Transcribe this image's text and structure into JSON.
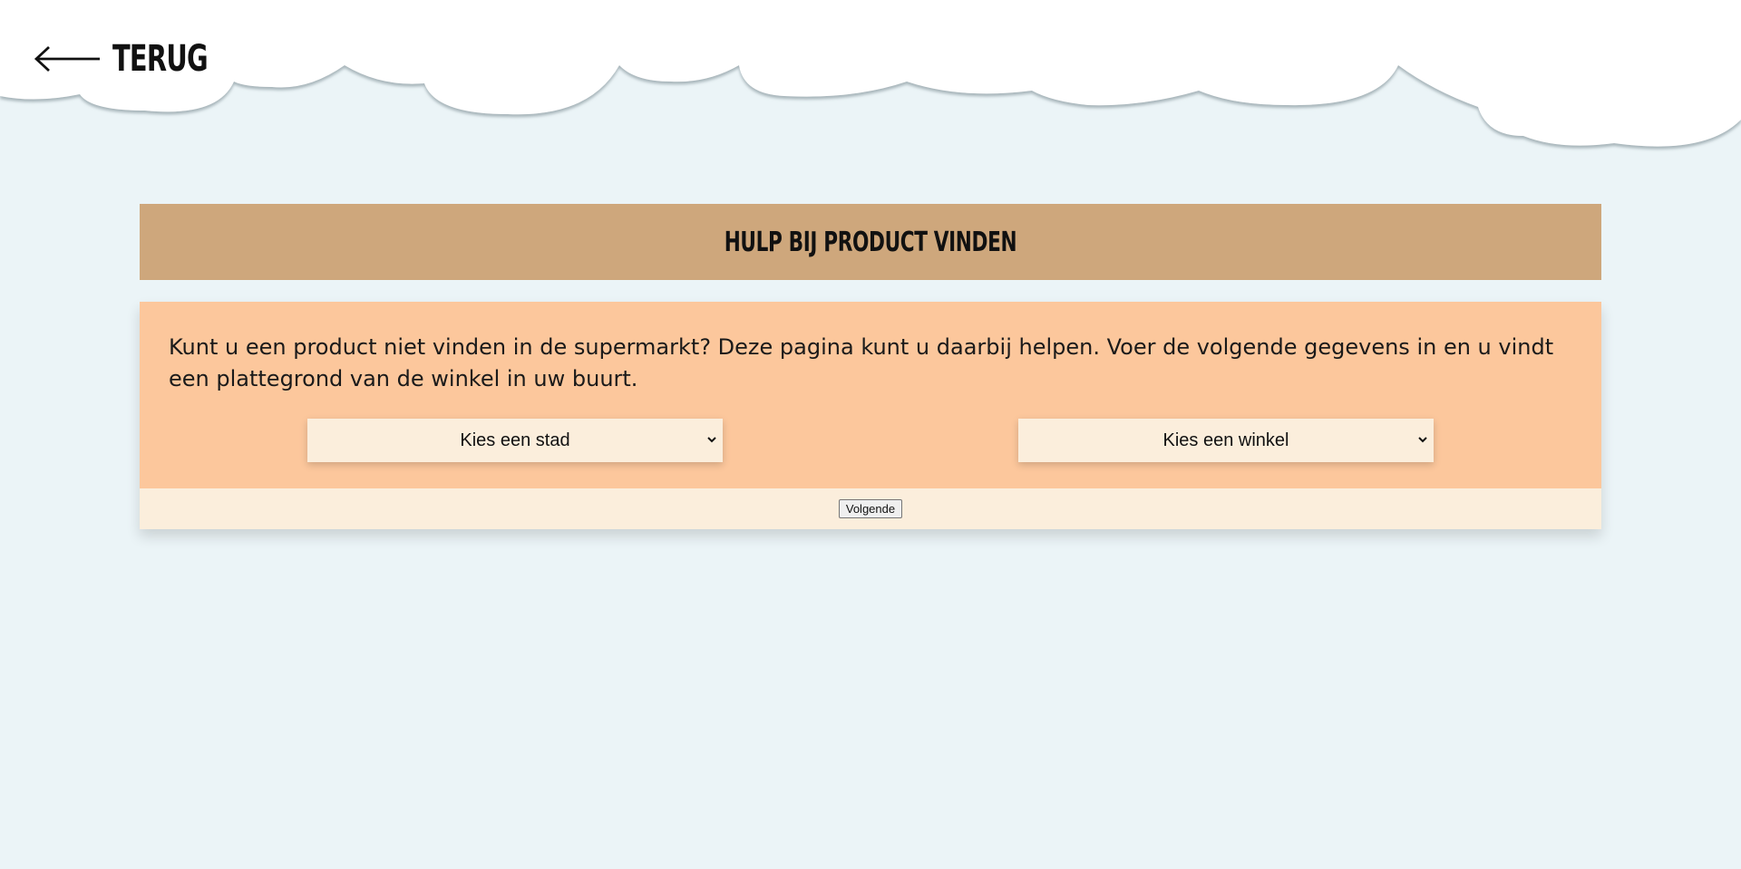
{
  "header": {
    "back_label": "TERUG",
    "back_icon": "arrow-left-icon"
  },
  "title": "HULP BIJ PRODUCT VINDEN",
  "form": {
    "intro": "Kunt u een product niet vinden in de supermarkt? Deze pagina kunt u daarbij helpen. Voer de volgende gegevens in en u vindt een plattegrond van de winkel in uw buurt.",
    "city_select": "Kies een stad",
    "shop_select": "Kies een winkel",
    "next_label": "Volgende"
  },
  "colors": {
    "background": "#ebf4f7",
    "clouds": "#ffffff",
    "title_bar": "#cea77c",
    "card_body": "#fcc79c",
    "card_footer": "#fbeedc"
  }
}
